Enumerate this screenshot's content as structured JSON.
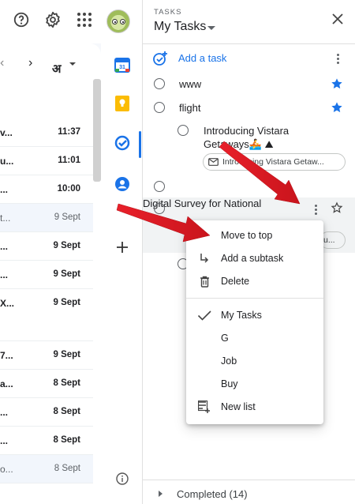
{
  "header": {
    "help_icon": "help-circle-icon",
    "settings_icon": "gear-icon",
    "apps_icon": "apps-grid-icon"
  },
  "mail": {
    "lang_label": "अ",
    "rows": [
      {
        "sender": "v...",
        "time": "11:37",
        "read": false
      },
      {
        "sender": "u...",
        "time": "11:01",
        "read": false
      },
      {
        "sender": "...",
        "time": "10:00",
        "read": false
      },
      {
        "sender": "t...",
        "time": "9 Sept",
        "read": true
      },
      {
        "sender": "...",
        "time": "9 Sept",
        "read": false
      },
      {
        "sender": "...",
        "time": "9 Sept",
        "read": false
      },
      {
        "sender": "X...",
        "time": "9 Sept",
        "read": false
      },
      {
        "sender": "7...",
        "time": "9 Sept",
        "read": false
      },
      {
        "sender": "a...",
        "time": "8 Sept",
        "read": false
      },
      {
        "sender": "...",
        "time": "8 Sept",
        "read": false
      },
      {
        "sender": "...",
        "time": "8 Sept",
        "read": false
      },
      {
        "sender": "o...",
        "time": "8 Sept",
        "read": true
      }
    ]
  },
  "tasks": {
    "kicker": "TASKS",
    "title": "My Tasks",
    "add_task": "Add a task",
    "items": [
      {
        "text": "www",
        "starred": true
      },
      {
        "text": "flight",
        "starred": true
      },
      {
        "text": "Introducing Vistara",
        "subtext": "Getaways🚣 ⛰",
        "chip": "Introducing Vistara Getaw..."
      },
      {
        "text": ""
      },
      {
        "text": "Digital Survey for National",
        "chip": "u..."
      }
    ],
    "completed": "Completed (14)"
  },
  "menu": {
    "items": [
      {
        "label": "Move to top",
        "icon": ""
      },
      {
        "label": "Add a subtask",
        "icon": "subtask-arrow-icon"
      },
      {
        "label": "Delete",
        "icon": "trash-icon"
      }
    ],
    "lists": [
      {
        "label": "My Tasks",
        "checked": true
      },
      {
        "label": "G",
        "checked": false
      },
      {
        "label": "Job",
        "checked": false
      },
      {
        "label": "Buy",
        "checked": false
      }
    ],
    "new_list": "New list"
  },
  "colors": {
    "accent": "#1a73e8",
    "arrow": "#e8202a"
  }
}
